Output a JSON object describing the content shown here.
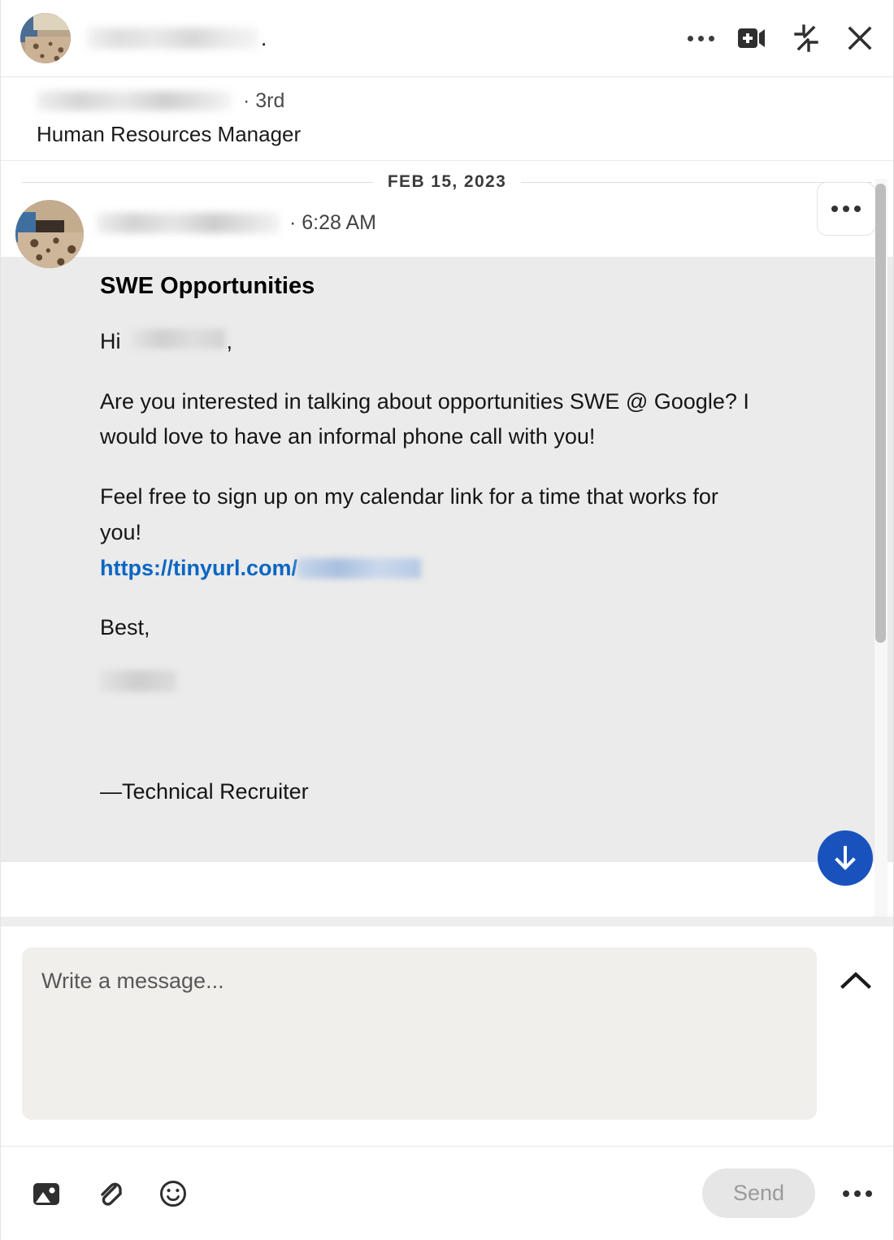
{
  "header": {
    "contact_name_redacted": true,
    "avatar": "contact-photo",
    "actions": [
      {
        "name": "more-options",
        "icon": "ellipsis-icon"
      },
      {
        "name": "video-meeting",
        "icon": "video-camera-plus-icon"
      },
      {
        "name": "minimize-window",
        "icon": "collapse-arrows-icon"
      },
      {
        "name": "close-window",
        "icon": "close-icon"
      }
    ]
  },
  "participant": {
    "name_redacted": true,
    "degree": "· 3rd",
    "title": "Human Resources Manager"
  },
  "thread": {
    "date_divider": "FEB 15, 2023",
    "message": {
      "sender_name_redacted": true,
      "time_separator": "·",
      "time": "6:28 AM",
      "menu_icon": "ellipsis-icon",
      "subject": "SWE Opportunities",
      "greeting_prefix": "Hi",
      "greeting_suffix": ",",
      "paragraph_1": "Are you interested in talking about opportunities SWE @ Google? I would love to have an informal phone call with you!",
      "paragraph_2": "Feel free to sign up on my calendar link for a time that works for you!",
      "link_text": "https://tinyurl.com/",
      "signoff": "Best,",
      "signature_name_redacted": true,
      "signature_line_redacted": true,
      "signature_role": "—Technical Recruiter"
    },
    "scroll_down_button": "scroll-to-bottom-icon"
  },
  "compose": {
    "placeholder": "Write a message...",
    "value": "",
    "collapse_icon": "chevron-up-icon"
  },
  "toolbar": {
    "tools": [
      {
        "name": "attach-image",
        "icon": "image-icon"
      },
      {
        "name": "attach-file",
        "icon": "paperclip-icon"
      },
      {
        "name": "insert-emoji",
        "icon": "smiley-icon"
      }
    ],
    "send_label": "Send",
    "send_enabled": false,
    "more_icon": "ellipsis-icon"
  },
  "colors": {
    "link_blue": "#0a66c2",
    "scroll_button_blue": "#1a52bd",
    "bubble_gray": "#ebebeb",
    "compose_gray": "#f0efeb",
    "send_disabled_bg": "#e6e6e6",
    "send_disabled_text": "#9a9a9a"
  }
}
